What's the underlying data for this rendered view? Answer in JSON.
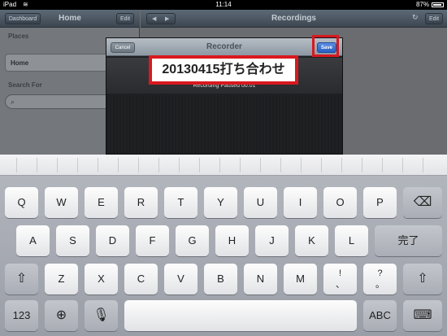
{
  "status_bar": {
    "carrier": "iPad",
    "wifi_icon": "wifi-icon",
    "time": "11:14",
    "battery": "87%"
  },
  "left_pane": {
    "back_button": "Dashboard",
    "title": "Home",
    "edit_button": "Edit",
    "places_label": "Places",
    "place_item": "Home",
    "search_label": "Search For"
  },
  "right_pane": {
    "title": "Recordings",
    "edit_button": "Edit"
  },
  "recorder": {
    "title": "Recorder",
    "cancel": "Cancel",
    "save": "Save",
    "name_value": "20130415打ち合わせ",
    "status": "Recording Paused 00:01"
  },
  "keyboard": {
    "row1": [
      "Q",
      "W",
      "E",
      "R",
      "T",
      "Y",
      "U",
      "I",
      "O",
      "P"
    ],
    "row2": [
      "A",
      "S",
      "D",
      "F",
      "G",
      "H",
      "J",
      "K",
      "L"
    ],
    "done": "完了",
    "row3": [
      "Z",
      "X",
      "C",
      "V",
      "B",
      "N",
      "M"
    ],
    "punct1_top": "!",
    "punct1_bottom": "、",
    "punct2_top": "?",
    "punct2_bottom": "。",
    "numbers": "123",
    "abc": "ABC"
  },
  "colors": {
    "highlight": "#d8191f",
    "save_blue": "#2860c4"
  }
}
